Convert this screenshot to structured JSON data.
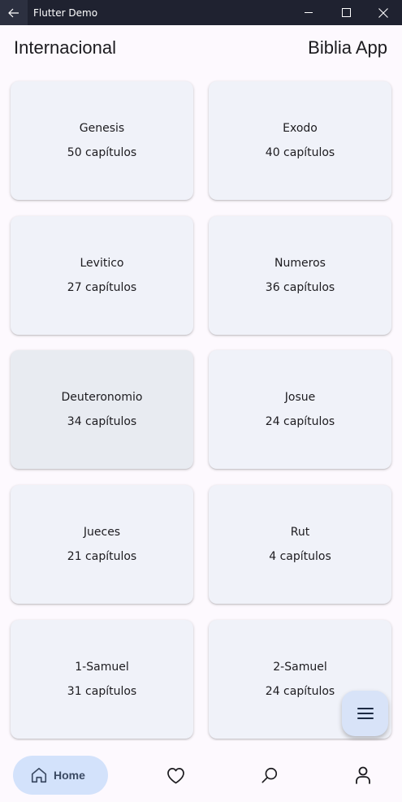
{
  "window": {
    "title": "Flutter Demo"
  },
  "appbar": {
    "left_title": "Internacional",
    "right_title": "Biblia App"
  },
  "books": [
    {
      "name": "Genesis",
      "chapters": "50 capítulos"
    },
    {
      "name": "Exodo",
      "chapters": "40 capítulos"
    },
    {
      "name": "Levitico",
      "chapters": "27 capítulos"
    },
    {
      "name": "Numeros",
      "chapters": "36 capítulos"
    },
    {
      "name": "Deuteronomio",
      "chapters": "34 capítulos"
    },
    {
      "name": "Josue",
      "chapters": "24 capítulos"
    },
    {
      "name": "Jueces",
      "chapters": "21 capítulos"
    },
    {
      "name": "Rut",
      "chapters": "4 capítulos"
    },
    {
      "name": "1-Samuel",
      "chapters": "31 capítulos"
    },
    {
      "name": "2-Samuel",
      "chapters": "24 capítulos"
    }
  ],
  "nav": {
    "home_label": "Home",
    "items": [
      "home-icon",
      "heart-icon",
      "search-icon",
      "person-icon"
    ]
  },
  "colors": {
    "titlebar": "#1f2230",
    "card": "#f0f2f9",
    "card_hover": "#e8ebf1",
    "nav_selected": "#d3e2fb",
    "fab": "#d8e3f8"
  }
}
